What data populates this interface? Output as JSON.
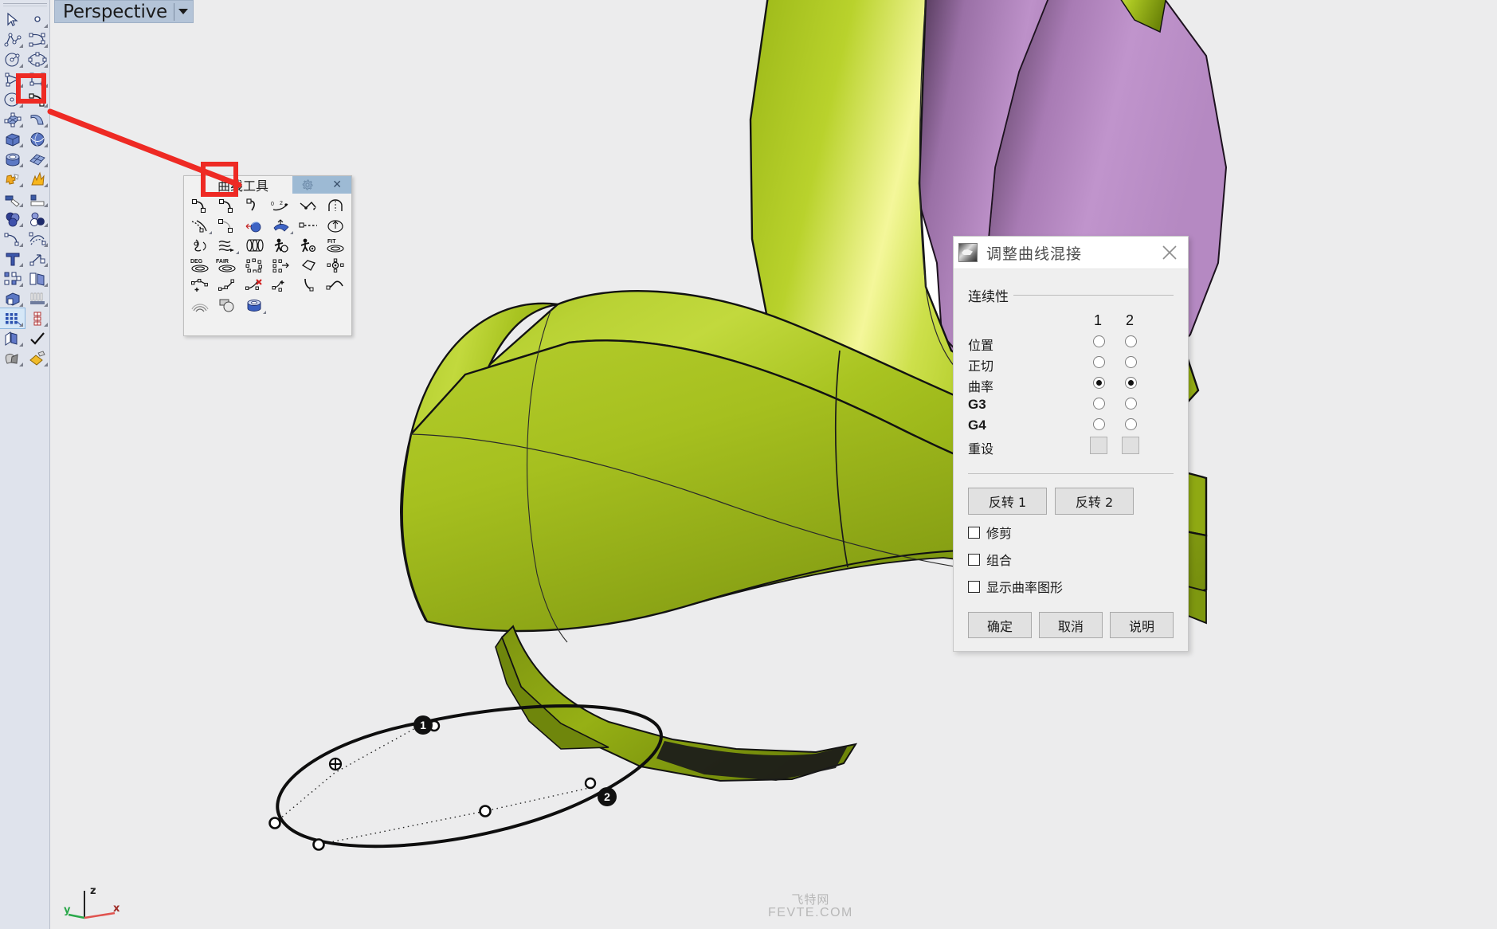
{
  "app": {
    "background_color": "#ececed",
    "toolbar_bg": "#dfe3ec",
    "accent_red": "#ee2a24",
    "surface_green": "#a4c020",
    "surface_purple": "#b083bd"
  },
  "viewport": {
    "tab_label": "Perspective",
    "caret_icon": "chevron-down-icon",
    "axis": {
      "x": "x",
      "y": "y",
      "z": "z",
      "x_color": "#c0392b",
      "y_color": "#27ae60",
      "z_color": "#222222"
    },
    "watermark_cn": "飞特网",
    "watermark_en": "FEVTE.COM"
  },
  "left_toolbar": {
    "items": [
      {
        "name": "select-arrow-tool",
        "icon": "cursor-arrow-icon"
      },
      {
        "name": "point-tool",
        "icon": "point-icon"
      },
      {
        "name": "polyline-tool",
        "icon": "polyline-icon"
      },
      {
        "name": "control-point-curve-tool",
        "icon": "control-curve-icon"
      },
      {
        "name": "circle-tool",
        "icon": "circle-icon"
      },
      {
        "name": "ellipse-tool",
        "icon": "ellipse-icon"
      },
      {
        "name": "polygon-tool",
        "icon": "polygon-icon"
      },
      {
        "name": "rectangle-tool",
        "icon": "rectangle-icon"
      },
      {
        "name": "arc-tool",
        "icon": "arc-icon"
      },
      {
        "name": "blend-curve-tool",
        "icon": "blend-curve-icon",
        "highlighted": true
      },
      {
        "name": "surface-from-points-tool",
        "icon": "surface-points-icon"
      },
      {
        "name": "surface-sweep-tool",
        "icon": "sweep-surface-icon"
      },
      {
        "name": "box-solid-tool",
        "icon": "box-icon"
      },
      {
        "name": "sphere-solid-tool",
        "icon": "sphere-icon"
      },
      {
        "name": "cylinder-solid-tool",
        "icon": "cylinder-icon"
      },
      {
        "name": "mesh-tool",
        "icon": "mesh-icon"
      },
      {
        "name": "boolean-tool",
        "icon": "puzzle-icon"
      },
      {
        "name": "explode-tool",
        "icon": "explode-icon"
      },
      {
        "name": "trim-tool",
        "icon": "trim-icon"
      },
      {
        "name": "split-tool",
        "icon": "split-icon"
      },
      {
        "name": "boolean-union-tool",
        "icon": "union-spheres-icon"
      },
      {
        "name": "boolean-difference-tool",
        "icon": "difference-spheres-icon"
      },
      {
        "name": "fillet-tool",
        "icon": "fillet-icon"
      },
      {
        "name": "offset-tool",
        "icon": "offset-icon"
      },
      {
        "name": "text-tool",
        "icon": "text-t-icon"
      },
      {
        "name": "dimension-tool",
        "icon": "dimension-arrow-icon"
      },
      {
        "name": "transform-tool",
        "icon": "transform-icon"
      },
      {
        "name": "copy-tool",
        "icon": "copy-icon"
      },
      {
        "name": "cplane-tool",
        "icon": "cplane-icon"
      },
      {
        "name": "lighting-tool",
        "icon": "lighting-icon"
      },
      {
        "name": "grid-tool",
        "icon": "grid-icon",
        "selected": true
      },
      {
        "name": "analysis-tool",
        "icon": "analysis-icon"
      },
      {
        "name": "layers-tool",
        "icon": "layers-icon"
      },
      {
        "name": "check-tool",
        "icon": "checkmark-icon"
      },
      {
        "name": "render-tool",
        "icon": "render-cone-icon"
      },
      {
        "name": "material-tool",
        "icon": "material-paint-icon"
      }
    ]
  },
  "curve_palette": {
    "title": "曲线工具",
    "gear_icon": "gear-icon",
    "close_icon": "close-icon",
    "highlighted_tool": "adjust-curve-blend-tool",
    "tools": [
      {
        "name": "blend-curve-1-tool",
        "icon": "blend-curve-icon"
      },
      {
        "name": "blend-curve-2-tool",
        "icon": "blend-curve-icon"
      },
      {
        "name": "arc-blend-tool",
        "icon": "arc-blend-icon"
      },
      {
        "name": "adjust-curve-blend-tool",
        "icon": "adjust-blend-icon",
        "label": "0 2"
      },
      {
        "name": "connect-curves-tool",
        "icon": "connect-curves-icon"
      },
      {
        "name": "zigzag-curve-tool",
        "icon": "zigzag-icon"
      },
      {
        "name": "arch-curve-tool",
        "icon": "arch-icon"
      },
      {
        "name": "extend-curve-tool",
        "icon": "extend-curve-icon"
      },
      {
        "name": "extend-smooth-tool",
        "icon": "extend-smooth-icon"
      },
      {
        "name": "project-curve-tool",
        "icon": "project-sphere-icon"
      },
      {
        "name": "pull-curve-tool",
        "icon": "pull-surface-icon"
      },
      {
        "name": "dotted-extend-tool",
        "icon": "dotted-extend-icon"
      },
      {
        "name": "offset-normal-tool",
        "icon": "offset-normal-icon"
      },
      {
        "name": "curve-boolean-tool",
        "icon": "curve-boolean-icon"
      },
      {
        "name": "flow-curve-tool",
        "icon": "flow-arrows-icon"
      },
      {
        "name": "loft-curve-tool",
        "icon": "loft-rings-icon"
      },
      {
        "name": "rebuild-person-tool",
        "icon": "person-wheel-icon"
      },
      {
        "name": "rebuild-person2-tool",
        "icon": "person-gear-icon"
      },
      {
        "name": "fit-curve-tool",
        "icon": "fit-spiral-icon",
        "label": "FIT"
      },
      {
        "name": "change-degree-tool",
        "icon": "degree-spiral-icon",
        "label": "DEG"
      },
      {
        "name": "fair-curve-tool",
        "icon": "fair-spiral-icon",
        "label": "FAIR"
      },
      {
        "name": "control-points-on-tool",
        "icon": "points-on-icon"
      },
      {
        "name": "insert-knot-tool",
        "icon": "insert-knot-icon"
      },
      {
        "name": "polygon-fit-tool",
        "icon": "polygon-fit-icon"
      },
      {
        "name": "move-points-tool",
        "icon": "move-points-icon"
      },
      {
        "name": "add-point-tool",
        "icon": "add-point-icon"
      },
      {
        "name": "edit-point-tool",
        "icon": "edit-point-icon"
      },
      {
        "name": "remove-point-tool",
        "icon": "remove-point-icon"
      },
      {
        "name": "add-kink-tool",
        "icon": "add-kink-icon"
      },
      {
        "name": "curve-hook-tool",
        "icon": "curve-hook-icon"
      },
      {
        "name": "curve-corner-tool",
        "icon": "curve-corner-icon"
      },
      {
        "name": "curvature-graph-tool",
        "icon": "curvature-graph-icon"
      },
      {
        "name": "curve-boolean2-tool",
        "icon": "curve-boolean2-icon"
      },
      {
        "name": "curve-pipe-tool",
        "icon": "curve-pipe-icon"
      }
    ]
  },
  "blend_dialog": {
    "title": "调整曲线混接",
    "close_icon": "close-icon",
    "continuity": {
      "group_label": "连续性",
      "column_headers": [
        "1",
        "2"
      ],
      "rows": [
        {
          "label": "位置",
          "name": "position",
          "col1": false,
          "col2": false
        },
        {
          "label": "正切",
          "name": "tangency",
          "col1": false,
          "col2": false
        },
        {
          "label": "曲率",
          "name": "curvature",
          "col1": true,
          "col2": true
        },
        {
          "label": "G3",
          "name": "g3",
          "col1": false,
          "col2": false
        },
        {
          "label": "G4",
          "name": "g4",
          "col1": false,
          "col2": false
        }
      ],
      "reset_label": "重设"
    },
    "flip_buttons": [
      {
        "label": "反转 1",
        "name": "flip-1-button"
      },
      {
        "label": "反转 2",
        "name": "flip-2-button"
      }
    ],
    "checkboxes": [
      {
        "label": "修剪",
        "name": "trim-checkbox",
        "checked": false
      },
      {
        "label": "组合",
        "name": "join-checkbox",
        "checked": false
      },
      {
        "label": "显示曲率图形",
        "name": "show-curvature-checkbox",
        "checked": false
      }
    ],
    "bottom_buttons": [
      {
        "label": "确定",
        "name": "ok-button"
      },
      {
        "label": "取消",
        "name": "cancel-button"
      },
      {
        "label": "说明",
        "name": "help-button"
      }
    ]
  },
  "scene": {
    "blend_markers": [
      {
        "label": "1",
        "name": "blend-marker-1"
      },
      {
        "label": "2",
        "name": "blend-marker-2"
      }
    ]
  }
}
